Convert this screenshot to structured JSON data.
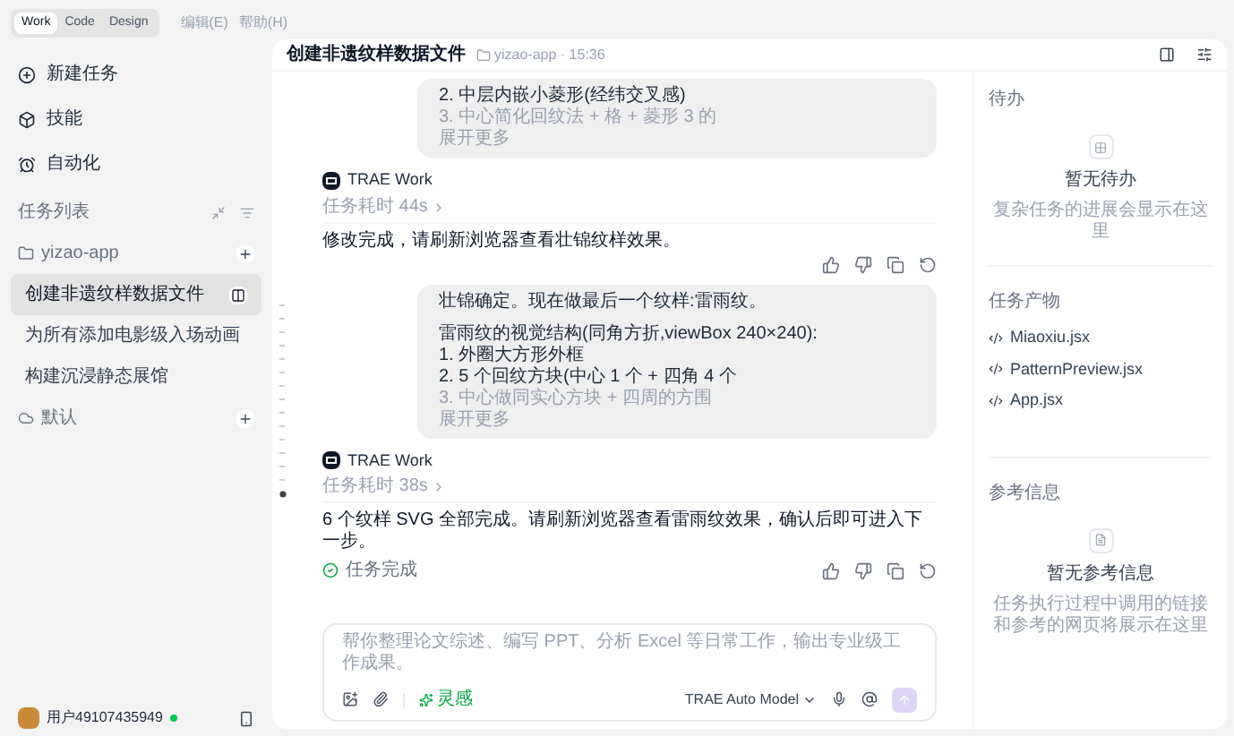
{
  "mode_tabs": [
    {
      "label": "Work",
      "selected": true
    },
    {
      "label": "Code",
      "selected": false
    },
    {
      "label": "Design",
      "selected": false
    }
  ],
  "menu": [
    "编辑(E)",
    "帮助(H)"
  ],
  "nav": [
    {
      "label": "新建任务",
      "kind": "new"
    },
    {
      "label": "技能",
      "kind": "skills"
    },
    {
      "label": "自动化",
      "kind": "auto"
    }
  ],
  "task_list": {
    "title": "任务列表",
    "groups": [
      {
        "name": "yizao-app",
        "kind": "folder",
        "tasks": [
          {
            "label": "创建非遗纹样数据文件",
            "selected": true
          },
          {
            "label": "为所有添加电影级入场动画",
            "selected": false
          },
          {
            "label": "构建沉浸静态展馆",
            "selected": false
          }
        ]
      },
      {
        "name": "默认",
        "kind": "cloud"
      }
    ]
  },
  "user": {
    "name": "用户49107435949",
    "online": true
  },
  "header": {
    "title": "创建非遗纹样数据文件",
    "project": "yizao-app · 15:36"
  },
  "messages": [
    {
      "kind": "user",
      "collapsed": true,
      "lines": [
        {
          "text": "2. 中层内嵌小菱形(经纬交叉感)"
        },
        {
          "text": "3. 中心简化回纹法 + 格 + 菱形 3 的"
        }
      ],
      "more": "展开更多"
    },
    {
      "kind": "agent",
      "name": "TRAE Work",
      "duration": "任务耗时 44s",
      "text": "修改完成，请刷新浏览器查看壮锦纹样效果。"
    },
    {
      "kind": "user",
      "collapsed": true,
      "lines": [
        {
          "text": "壮锦确定。现在做最后一个纹样:雷雨纹。"
        },
        {
          "text": "雷雨纹的视觉结构(同角方折,viewBox 240×240):",
          "new_paragraph": true
        },
        {
          "text": "1. 外圈大方形外框"
        },
        {
          "text": "2. 5 个回纹方块(中心 1 个 + 四角 4 个"
        },
        {
          "text": "3. 中心做同实心方块 + 四周的方围"
        }
      ],
      "more": "展开更多"
    },
    {
      "kind": "agent",
      "name": "TRAE Work",
      "duration": "任务耗时 38s",
      "text": "6 个纹样 SVG 全部完成。请刷新浏览器查看雷雨纹效果，确认后即可进入下一步。",
      "status": "任务完成"
    }
  ],
  "composer": {
    "placeholder": "帮你整理论文综述、编写 PPT、分析 Excel 等日常工作，输出专业级工作成果。",
    "inspiration": "灵感",
    "model": "TRAE Auto Model"
  },
  "panel": {
    "todo": {
      "title": "待办",
      "empty_title": "暂无待办",
      "empty_text": "复杂任务的进展会显示在这里"
    },
    "outputs": {
      "title": "任务产物",
      "files": [
        "Miaoxiu.jsx",
        "PatternPreview.jsx",
        "App.jsx"
      ]
    },
    "refs": {
      "title": "参考信息",
      "empty_title": "暂无参考信息",
      "empty_text": "任务执行过程中调用的链接和参考的网页将展示在这里"
    }
  }
}
